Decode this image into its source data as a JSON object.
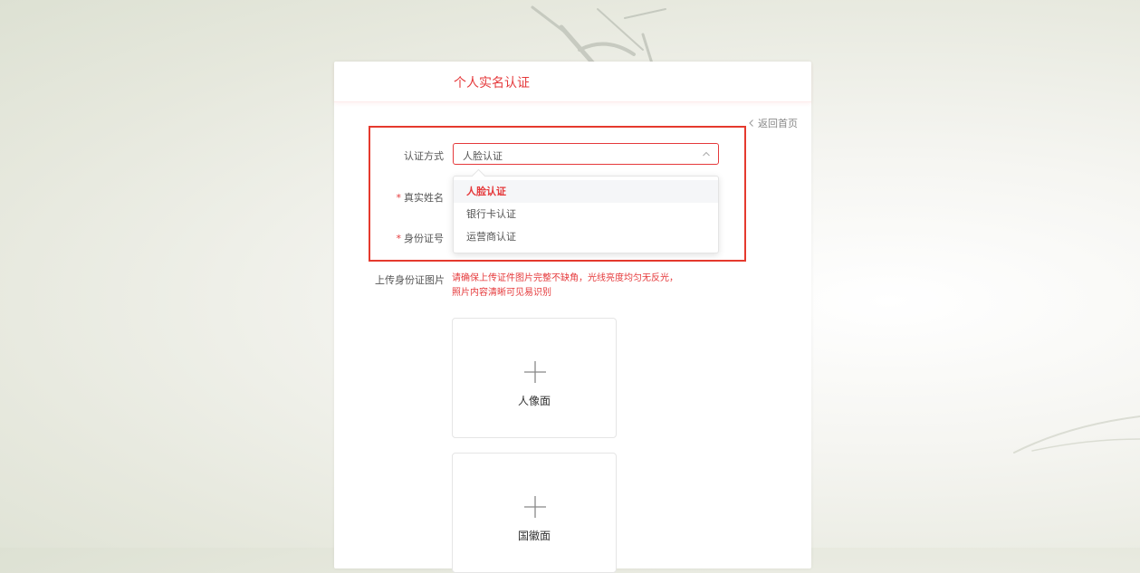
{
  "card": {
    "title": "个人实名认证",
    "back_link": "返回首页"
  },
  "form": {
    "method_label": "认证方式",
    "method_value": "人脸认证",
    "name_label": "真实姓名",
    "id_label": "身份证号",
    "required_mark": "*",
    "upload_label": "上传身份证图片",
    "upload_hint": "请确保上传证件图片完整不缺角，光线亮度均匀无反光，照片内容清晰可见易识别"
  },
  "dropdown": {
    "options": [
      {
        "label": "人脸认证",
        "selected": true
      },
      {
        "label": "银行卡认证",
        "selected": false
      },
      {
        "label": "运营商认证",
        "selected": false
      }
    ]
  },
  "uploads": [
    {
      "label": "人像面",
      "icon": "plus-icon"
    },
    {
      "label": "国徽面",
      "icon": "plus-icon"
    }
  ],
  "colors": {
    "accent": "#e5393b",
    "highlight_border": "#e53a2e"
  }
}
